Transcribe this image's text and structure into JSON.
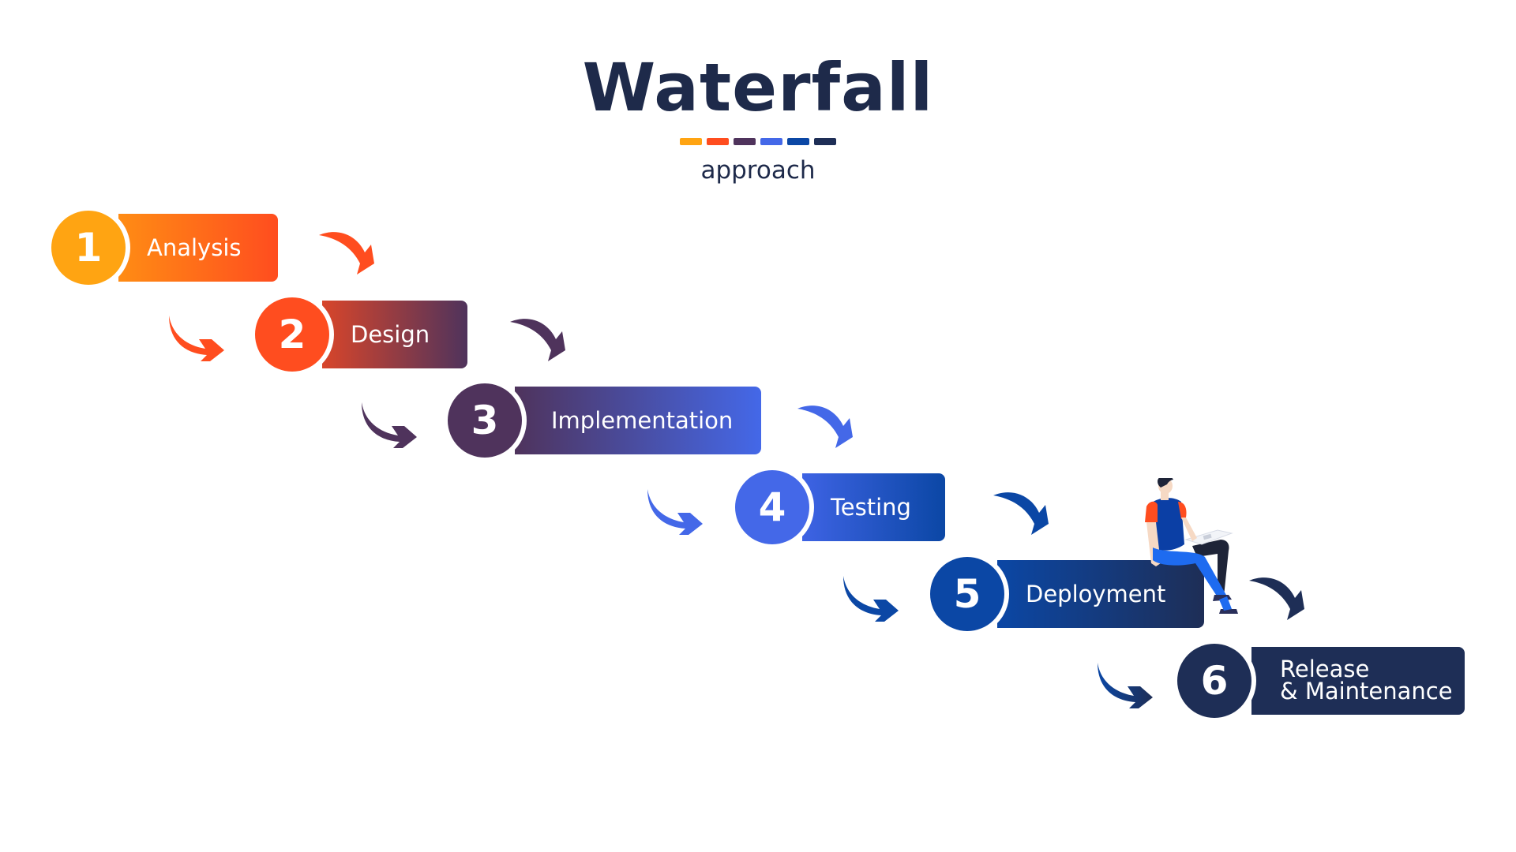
{
  "header": {
    "title": "Waterfall",
    "subtitle": "approach",
    "swatch_colors": [
      "#FFA412",
      "#FF4D1F",
      "#4F335C",
      "#4468E8",
      "#0B47A5",
      "#1E2E56"
    ]
  },
  "steps": [
    {
      "number": "1",
      "label": "Analysis",
      "circle_color": "#FFA412",
      "bar_from": "#FF8C14",
      "bar_to": "#FF4D1F",
      "arrow_color": "#FF4D1F"
    },
    {
      "number": "2",
      "label": "Design",
      "circle_color": "#FF4D1F",
      "bar_from": "#D8452A",
      "bar_to": "#4F335C",
      "arrow_color": "#4F335C"
    },
    {
      "number": "3",
      "label": "Implementation",
      "circle_color": "#4F335C",
      "bar_from": "#4F335C",
      "bar_to": "#4468E8",
      "arrow_color": "#4468E8"
    },
    {
      "number": "4",
      "label": "Testing",
      "circle_color": "#4468E8",
      "bar_from": "#3E63E4",
      "bar_to": "#0B47A5",
      "arrow_color": "#0B47A5"
    },
    {
      "number": "5",
      "label": "Deployment",
      "circle_color": "#0B47A5",
      "bar_from": "#0B47A5",
      "bar_to": "#1E2E56",
      "arrow_color": "#1E2E56"
    },
    {
      "number": "6",
      "label_line1": "Release",
      "label_line2": "& Maintenance",
      "circle_color": "#1E2E56",
      "bar_from": "#1E2E56",
      "bar_to": "#1E2E56"
    }
  ],
  "left_arrows": [
    {
      "color": "#FF4D1F"
    },
    {
      "color": "#4F335C"
    },
    {
      "color": "#4468E8"
    },
    {
      "color": "#0B47A5"
    },
    {
      "color_from": "#0B47A5",
      "color_to": "#1E2E56"
    }
  ],
  "illustration": {
    "subject": "person-sitting-with-laptop"
  }
}
